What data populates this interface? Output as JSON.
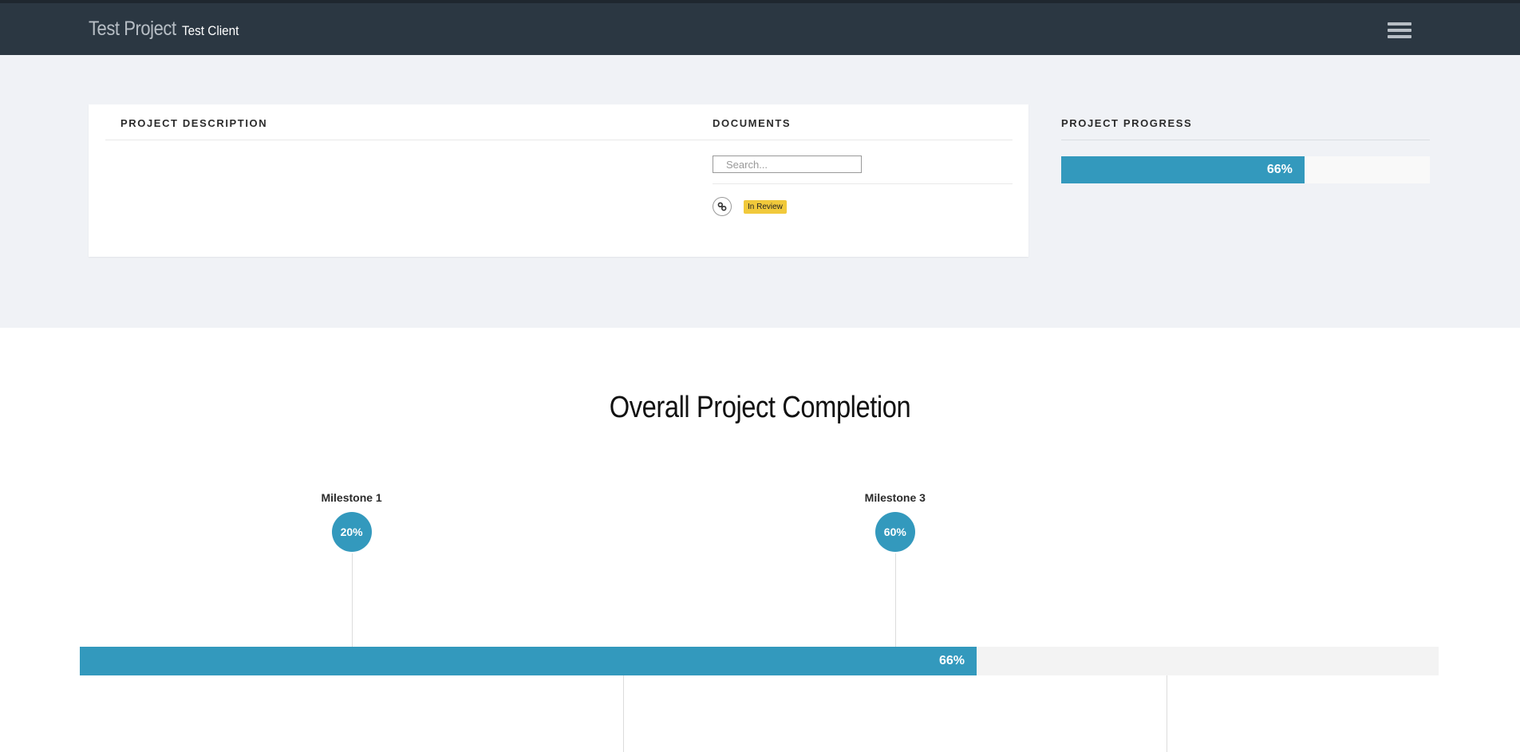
{
  "header": {
    "project_name": "Test Project",
    "client_name": "Test Client"
  },
  "card": {
    "description_title": "PROJECT DESCRIPTION",
    "documents_title": "DOCUMENTS",
    "search_placeholder": "Search...",
    "document_status": "In Review"
  },
  "progress": {
    "title": "PROJECT PROGRESS",
    "percent": 66,
    "label": "66%"
  },
  "overall": {
    "title": "Overall Project Completion",
    "percent": 66,
    "label": "66%",
    "milestones": [
      {
        "name": "Milestone 1",
        "label": "20%",
        "percent": 20
      },
      {
        "name": "Milestone 3",
        "label": "60%",
        "percent": 60
      }
    ]
  },
  "colors": {
    "accent": "#3399bd",
    "topbar": "#2b3742",
    "badge": "#f1c93b"
  }
}
